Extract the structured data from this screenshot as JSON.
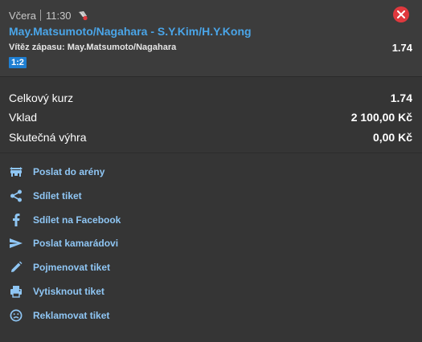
{
  "ticket": {
    "date": "Včera",
    "time": "11:30",
    "sport_icon": "badminton-shuttlecock-icon",
    "close_icon": "close-icon",
    "match": "May.Matsumoto/Nagahara - S.Y.Kim/H.Y.Kong",
    "market_label": "Vítěz zápasu: May.Matsumoto/Nagahara",
    "odds": "1.74",
    "score": "1:2"
  },
  "summary": {
    "total_odds_label": "Celkový kurz",
    "total_odds_value": "1.74",
    "stake_label": "Vklad",
    "stake_value": "2 100,00 Kč",
    "payout_label": "Skutečná výhra",
    "payout_value": "0,00 Kč"
  },
  "actions": [
    {
      "label": "Poslat do arény",
      "icon": "arena-icon"
    },
    {
      "label": "Sdílet tiket",
      "icon": "share-icon"
    },
    {
      "label": "Sdílet na Facebook",
      "icon": "facebook-icon"
    },
    {
      "label": "Poslat kamarádovi",
      "icon": "send-icon"
    },
    {
      "label": "Pojmenovat tiket",
      "icon": "pencil-icon"
    },
    {
      "label": "Vytisknout tiket",
      "icon": "printer-icon"
    },
    {
      "label": "Reklamovat tiket",
      "icon": "sad-face-icon"
    }
  ],
  "colors": {
    "accent": "#4aa5e8",
    "link": "#8fc6f4",
    "close": "#e0393e",
    "badge": "#1f7fd2",
    "background": "#353535"
  }
}
